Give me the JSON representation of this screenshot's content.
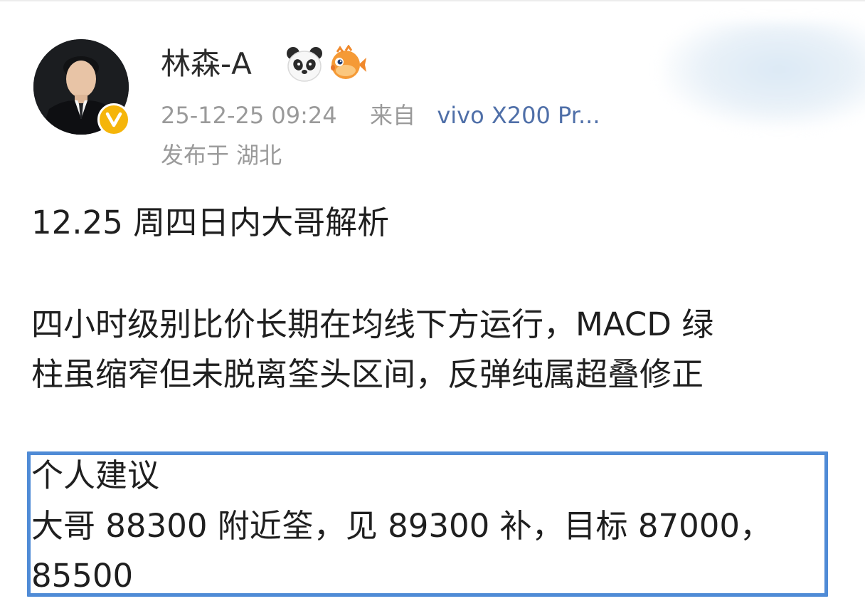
{
  "post_header": {
    "username": "林森-A",
    "username_badges": [
      "panda-emoji-icon",
      "pufferfish-emoji-icon"
    ],
    "timestamp": "25-12-25 09:24",
    "source_prefix": "来自",
    "device": "vivo X200 Pr...",
    "location": "发布于 湖北"
  },
  "post_body": {
    "title": "12.25 周四日内大哥解析",
    "analysis_lines": [
      "四小时级别比价长期在均线下方运行，MACD 绿",
      "柱虽缩窄但未脱离筌头区间，反弹纯属超叠修正"
    ],
    "advice": {
      "heading": "个人建议",
      "lines": [
        "大哥 88300 附近筌，见 89300 补，目标 87000，",
        "85500"
      ]
    }
  },
  "colors": {
    "text_primary": "#1f1f1f",
    "text_meta": "#9a9a9a",
    "device_link": "#4f6fa8",
    "verified_badge": "#f5b50a",
    "highlight_border": "#4f8bd6"
  }
}
